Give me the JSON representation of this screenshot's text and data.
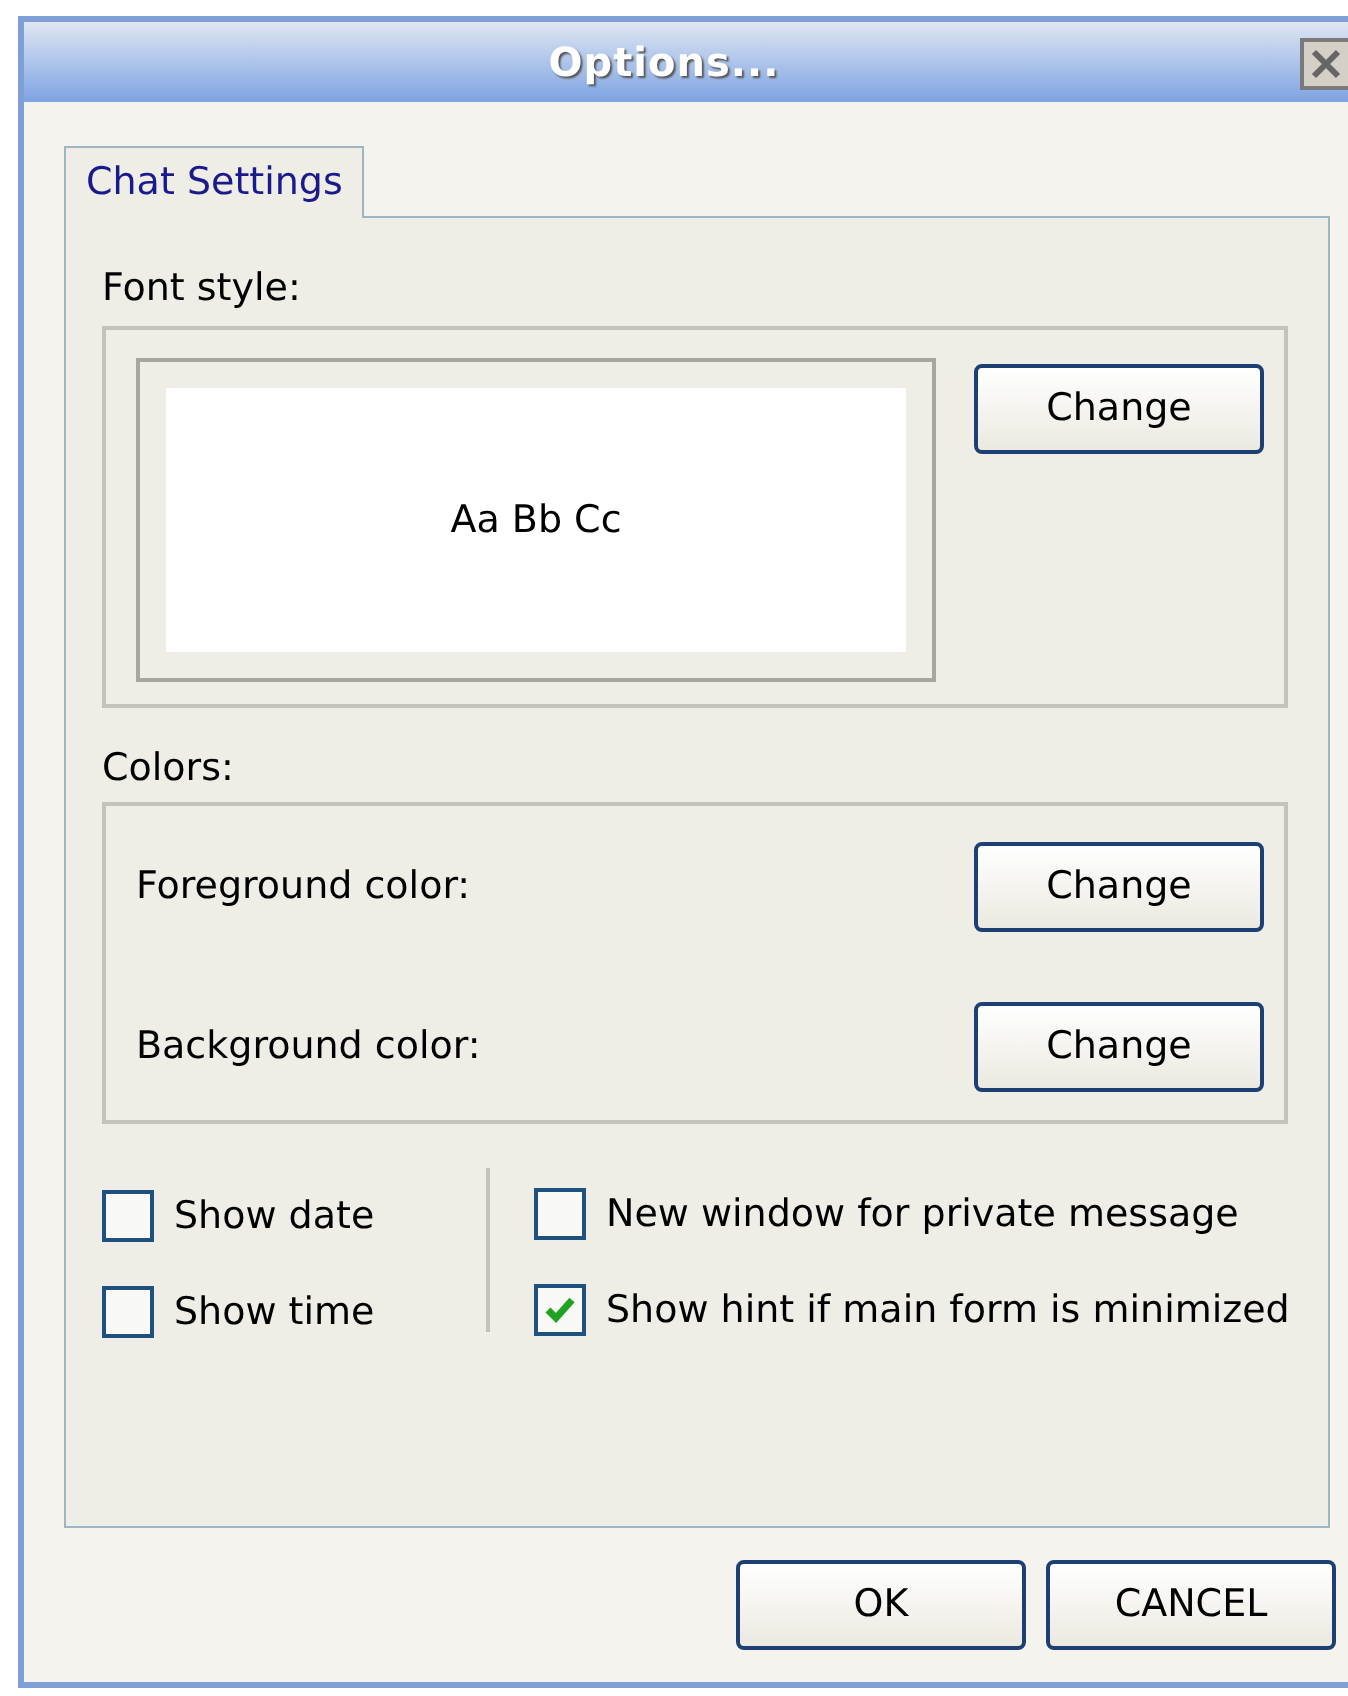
{
  "window": {
    "title": "Options..."
  },
  "tabs": [
    {
      "label": "Chat Settings",
      "selected": true
    }
  ],
  "font_style": {
    "label": "Font style:",
    "preview": "Aa Bb Cc",
    "button": "Change"
  },
  "colors": {
    "label": "Colors:",
    "rows": [
      {
        "label": "Foreground color:",
        "button": "Change"
      },
      {
        "label": "Background color:",
        "button": "Change"
      }
    ]
  },
  "options_left": [
    {
      "label": "Show date",
      "checked": false
    },
    {
      "label": "Show time",
      "checked": false
    }
  ],
  "options_right": [
    {
      "label": "New window for private message",
      "checked": false
    },
    {
      "label": "Show hint if main form is minimized",
      "checked": true
    }
  ],
  "buttons": [
    {
      "label": "OK"
    },
    {
      "label": "CANCEL"
    }
  ]
}
